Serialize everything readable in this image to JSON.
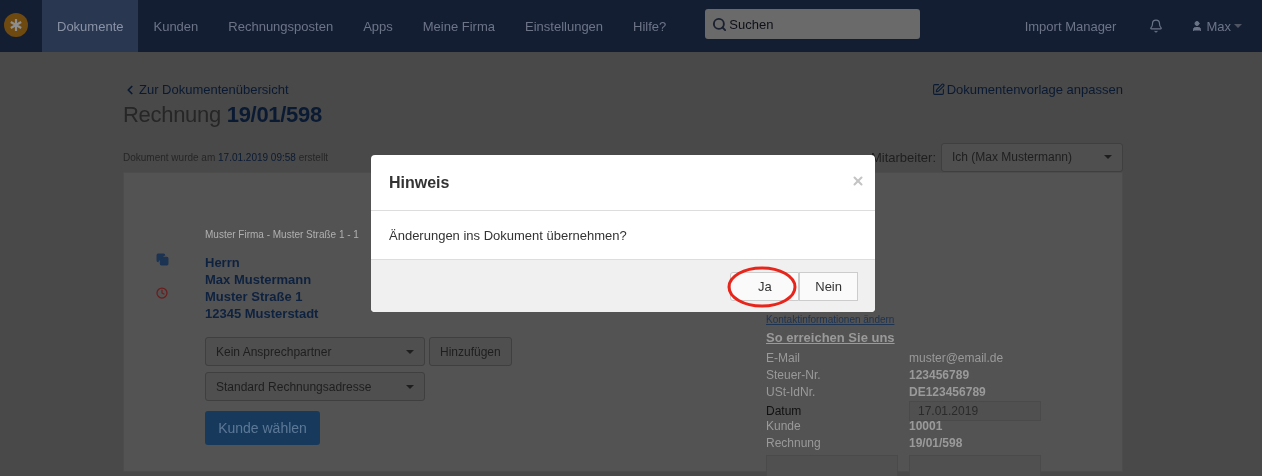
{
  "navbar": {
    "items": [
      {
        "label": "Dokumente",
        "selected": true
      },
      {
        "label": "Kunden",
        "selected": false
      },
      {
        "label": "Rechnungsposten",
        "selected": false
      },
      {
        "label": "Apps",
        "selected": false
      },
      {
        "label": "Meine Firma",
        "selected": false
      },
      {
        "label": "Einstellungen",
        "selected": false
      },
      {
        "label": "Hilfe?",
        "selected": false
      }
    ],
    "search": {
      "placeholder": "Suchen"
    },
    "import_manager": "Import Manager",
    "user": "Max"
  },
  "page": {
    "back_link": "Zur Dokumentenübersicht",
    "title": "Rechnung",
    "number": "19/01/598",
    "edit_template_link": "Dokumentenvorlage anpassen",
    "created": {
      "prefix": "Dokument wurde am",
      "date": "17.01.2019 09:58",
      "suffix": "erstellt"
    },
    "employee": {
      "label": "Mitarbeiter:",
      "value": "Ich (Max Mustermann)"
    }
  },
  "document": {
    "sender_line": "Muster Firma - Muster Straße 1 - 1",
    "recipient": [
      "Herrn",
      "Max Mustermann",
      "Muster Straße 1",
      "12345 Musterstadt"
    ],
    "contact_select": "Kein Ansprechpartner",
    "add_button": "Hinzufügen",
    "address_select": "Standard Rechnungsadresse",
    "choose_customer_button": "Kunde wählen",
    "contact_link": "Kontaktinformationen ändern",
    "contact_heading": "So erreichen Sie uns",
    "info": [
      {
        "kind": "text",
        "label": "E-Mail",
        "value": "muster@email.de"
      },
      {
        "kind": "bold",
        "label": "Steuer-Nr.",
        "value": "123456789"
      },
      {
        "kind": "bold",
        "label": "USt-IdNr.",
        "value": "DE123456789"
      },
      {
        "kind": "field",
        "label": "Datum",
        "value": "17.01.2019"
      },
      {
        "kind": "bold",
        "label": "Kunde",
        "value": "10001"
      },
      {
        "kind": "bold",
        "label": "Rechnung",
        "value": "19/01/598"
      }
    ]
  },
  "dialog": {
    "title": "Hinweis",
    "message": "Änderungen ins Dokument übernehmen?",
    "buttons": [
      {
        "label": "Ja",
        "highlighted": true
      },
      {
        "label": "Nein",
        "highlighted": false
      }
    ]
  }
}
